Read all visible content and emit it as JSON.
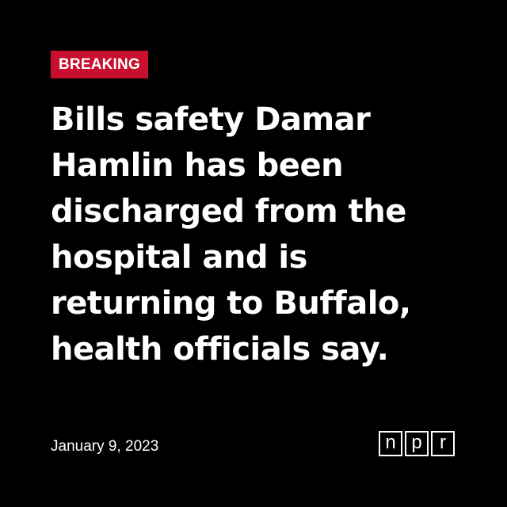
{
  "badge": {
    "label": "BREAKING",
    "color": "#c8102e"
  },
  "headline": {
    "lines": [
      "Bills safety Damar",
      "Hamlin has been",
      "discharged from the",
      "hospital and is",
      "returning to Buffalo,",
      "health officials say."
    ]
  },
  "date": "January 9, 2023",
  "logo": {
    "letters": [
      "n",
      "p",
      "r"
    ]
  },
  "colors": {
    "background": "#000000",
    "text": "#ffffff",
    "accent": "#c8102e"
  }
}
